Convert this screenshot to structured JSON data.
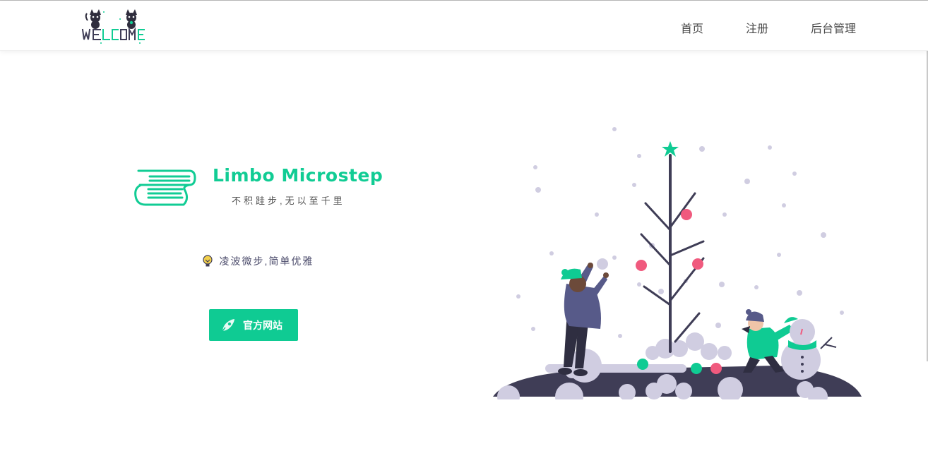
{
  "header": {
    "logo_text": "WELCOME",
    "nav": [
      {
        "label": "首页"
      },
      {
        "label": "注册"
      },
      {
        "label": "后台管理"
      }
    ]
  },
  "hero": {
    "brand_title": "Limbo Microstep",
    "brand_subtitle": "不积跬步,无以至千里",
    "tagline": "凌波微步,简单优雅",
    "button_label": "官方网站"
  },
  "colors": {
    "accent": "#0fcb93",
    "nav_text": "#4a4a4a",
    "dark": "#3f3d56",
    "snow": "#d0cde1",
    "ornament_red": "#f05a7e"
  },
  "icons": {
    "book": "book-icon",
    "tagline": "lightbulb-icon",
    "button": "rocket-icon"
  }
}
